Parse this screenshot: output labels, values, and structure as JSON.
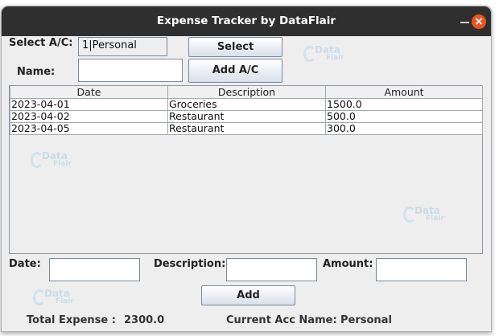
{
  "window": {
    "title": "Expense Tracker by DataFlair"
  },
  "account": {
    "select_label": "Select A/C:",
    "selected_value": "1|Personal",
    "select_button": "Select",
    "name_label": "Name:",
    "name_value": "",
    "add_button": "Add A/C"
  },
  "table": {
    "columns": [
      "Date",
      "Description",
      "Amount"
    ],
    "rows": [
      [
        "2023-04-01",
        "Groceries",
        "1500.0"
      ],
      [
        "2023-04-02",
        "Restaurant",
        "500.0"
      ],
      [
        "2023-04-05",
        "Restaurant",
        "300.0"
      ]
    ]
  },
  "entry": {
    "date_label": "Date:",
    "date_value": "",
    "description_label": "Description:",
    "description_value": "",
    "amount_label": "Amount:",
    "amount_value": "",
    "add_button": "Add"
  },
  "summary": {
    "total_label": "Total Expense :",
    "total_value": "2300.0",
    "current_label": "Current Acc Name:",
    "current_value": "Personal"
  },
  "watermark": {
    "line1": "Data",
    "line2": "Flair"
  }
}
